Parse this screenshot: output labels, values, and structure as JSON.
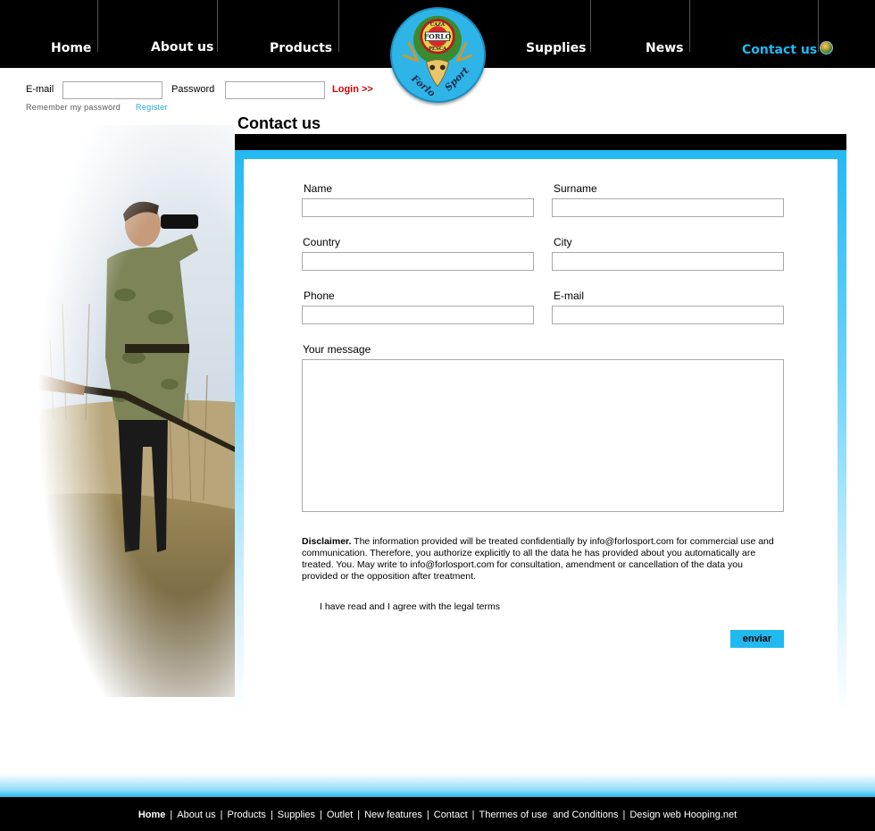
{
  "nav": {
    "items": [
      {
        "label": "Home"
      },
      {
        "label": "About us"
      },
      {
        "label": "Products"
      },
      {
        "label": "Supplies"
      },
      {
        "label": "News"
      },
      {
        "label": "Contact us"
      }
    ],
    "active_color": "#22b8f0"
  },
  "logo": {
    "top_text": "CAZA",
    "center_text": "FORLO",
    "bottom_text": "PESCA",
    "script_left": "Forlo",
    "script_right": "Sport"
  },
  "login": {
    "email_label": "E-mail",
    "password_label": "Password",
    "login_link": "Login >>",
    "remember_text": "Remember my password",
    "register_link": "Register"
  },
  "main": {
    "title": "Contact us",
    "fields": {
      "name": {
        "label": "Name",
        "value": ""
      },
      "surname": {
        "label": "Surname",
        "value": ""
      },
      "country": {
        "label": "Country",
        "value": ""
      },
      "city": {
        "label": "City",
        "value": ""
      },
      "phone": {
        "label": "Phone",
        "value": ""
      },
      "email": {
        "label": "E-mail",
        "value": ""
      },
      "message": {
        "label": "Your message",
        "value": ""
      }
    },
    "disclaimer_heading": "Disclaimer.",
    "disclaimer_text": " The information provided will be treated confidentially by info@forlosport.com for commercial use and communication. Therefore, you authorize explicitly to all the data he has provided about you automatically are treated. You. May write to info@forlosport.com for consultation, amendment or cancellation of the data you provided or the opposition after treatment.",
    "terms_label": "I have read and I agree with the legal terms",
    "send_button": "enviar"
  },
  "footer": {
    "links": [
      "Home",
      "About us",
      "Products",
      "Supplies",
      "Outlet",
      "New features",
      "Contact",
      "Thermes of use  and Conditions",
      "Design web Hooping.net"
    ]
  },
  "colors": {
    "accent": "#22b8f0",
    "login_red": "#d40000",
    "nav_bg": "#000000"
  }
}
